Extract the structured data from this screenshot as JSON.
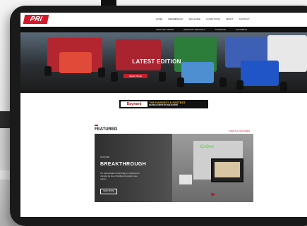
{
  "colors": {
    "brand_red": "#d7182a",
    "nav_dark": "#111111",
    "ad_yellow": "#f2c12e",
    "exone_green": "#7ecb6e"
  },
  "site": {
    "logo_text": "PRI"
  },
  "nav": {
    "top_links": [
      "HOME",
      "MEMBERSHIP",
      "MAGAZINE",
      "CONDITIONS",
      "ABOUT",
      "CONTACT"
    ],
    "sub_links": [
      "INDUSTRY NEWS",
      "INDUSTRY REPORTS",
      "DATABASE",
      "RACEBEAT"
    ]
  },
  "hero": {
    "title": "LATEST EDITION",
    "button_label": "READ ISSUE"
  },
  "ad": {
    "left_label": "Bayward",
    "headline": "THE HARDEST & FASTEST",
    "subline": "RACING EVENTS ON THE NATION"
  },
  "featured": {
    "heading": "FEATURED",
    "view_all_label": "VIEW ALL FEATURES",
    "card": {
      "kicker": "FEATURED",
      "title": "BREAKTHROUGH",
      "description": "The rapid adoption of technology in motorsports is changing the face of building and repairing race engines",
      "button_label": "READ MORE",
      "brand": "ExOne"
    }
  }
}
